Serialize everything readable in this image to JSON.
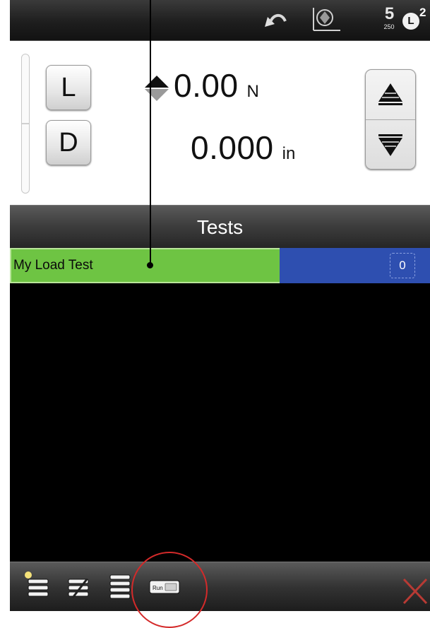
{
  "topbar": {
    "icons": [
      "undo-icon",
      "zero-axis-icon",
      "sample-rate-icon",
      "load-limit-icon"
    ],
    "sample_rate": {
      "value": "5",
      "sub": "250"
    },
    "load_badge": {
      "letter": "L",
      "superscript": "2"
    }
  },
  "readout": {
    "load_key": "L",
    "distance_key": "D",
    "load_value": "0.00",
    "load_unit": "N",
    "distance_value": "0.000",
    "distance_unit": "in"
  },
  "tests": {
    "header": "Tests",
    "items": [
      {
        "name": "My Load Test",
        "count": "0"
      }
    ]
  },
  "toolbar": {
    "icons": [
      "new-test-icon",
      "edit-test-icon",
      "test-list-icon",
      "run-test-icon",
      "delete-icon"
    ],
    "run_label": "Run"
  },
  "colors": {
    "selected_row": "#6ec443",
    "count_cell": "#2e4fb0",
    "callout_circle": "#d42a2a",
    "delete_x": "#b83a34"
  }
}
